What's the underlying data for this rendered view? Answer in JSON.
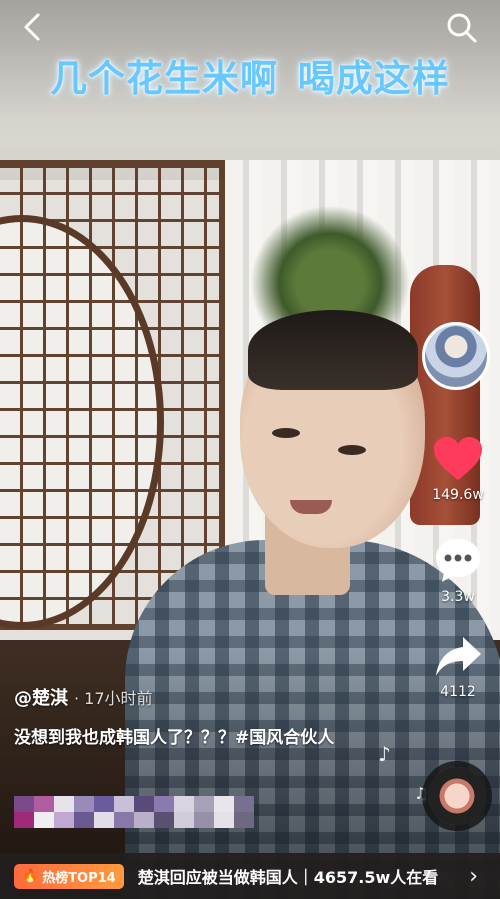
{
  "header": {
    "title": "几个花生米啊  喝成这样"
  },
  "actions": {
    "like_count": "149.6w",
    "comment_count": "3.3w",
    "share_count": "4112"
  },
  "post": {
    "author": "@楚淇",
    "time": "· 17小时前",
    "description": "没想到我也成韩国人了？？？#国风合伙人"
  },
  "hot_bar": {
    "badge": "热榜TOP14",
    "text": "楚淇回应被当做韩国人｜4657.5w人在看"
  },
  "colors": {
    "title": "#66c8ff",
    "like": "#ff3b5c",
    "hot_badge": "#ff6a3d"
  },
  "icons": [
    "back-icon",
    "search-icon",
    "heart-icon",
    "comment-icon",
    "share-icon",
    "music-note-icon",
    "music-disc",
    "chevron-right-icon"
  ]
}
